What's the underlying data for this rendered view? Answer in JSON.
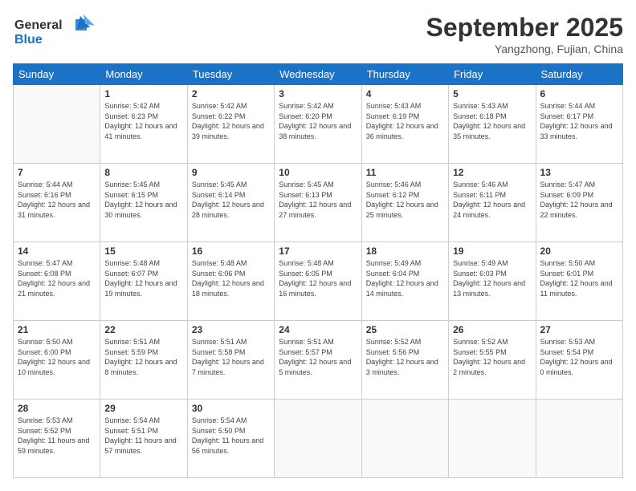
{
  "logo": {
    "line1": "General",
    "line2": "Blue"
  },
  "title": "September 2025",
  "location": "Yangzhong, Fujian, China",
  "days_of_week": [
    "Sunday",
    "Monday",
    "Tuesday",
    "Wednesday",
    "Thursday",
    "Friday",
    "Saturday"
  ],
  "weeks": [
    [
      {
        "day": "",
        "detail": ""
      },
      {
        "day": "1",
        "detail": "Sunrise: 5:42 AM\nSunset: 6:23 PM\nDaylight: 12 hours\nand 41 minutes."
      },
      {
        "day": "2",
        "detail": "Sunrise: 5:42 AM\nSunset: 6:22 PM\nDaylight: 12 hours\nand 39 minutes."
      },
      {
        "day": "3",
        "detail": "Sunrise: 5:42 AM\nSunset: 6:20 PM\nDaylight: 12 hours\nand 38 minutes."
      },
      {
        "day": "4",
        "detail": "Sunrise: 5:43 AM\nSunset: 6:19 PM\nDaylight: 12 hours\nand 36 minutes."
      },
      {
        "day": "5",
        "detail": "Sunrise: 5:43 AM\nSunset: 6:18 PM\nDaylight: 12 hours\nand 35 minutes."
      },
      {
        "day": "6",
        "detail": "Sunrise: 5:44 AM\nSunset: 6:17 PM\nDaylight: 12 hours\nand 33 minutes."
      }
    ],
    [
      {
        "day": "7",
        "detail": "Sunrise: 5:44 AM\nSunset: 6:16 PM\nDaylight: 12 hours\nand 31 minutes."
      },
      {
        "day": "8",
        "detail": "Sunrise: 5:45 AM\nSunset: 6:15 PM\nDaylight: 12 hours\nand 30 minutes."
      },
      {
        "day": "9",
        "detail": "Sunrise: 5:45 AM\nSunset: 6:14 PM\nDaylight: 12 hours\nand 28 minutes."
      },
      {
        "day": "10",
        "detail": "Sunrise: 5:45 AM\nSunset: 6:13 PM\nDaylight: 12 hours\nand 27 minutes."
      },
      {
        "day": "11",
        "detail": "Sunrise: 5:46 AM\nSunset: 6:12 PM\nDaylight: 12 hours\nand 25 minutes."
      },
      {
        "day": "12",
        "detail": "Sunrise: 5:46 AM\nSunset: 6:11 PM\nDaylight: 12 hours\nand 24 minutes."
      },
      {
        "day": "13",
        "detail": "Sunrise: 5:47 AM\nSunset: 6:09 PM\nDaylight: 12 hours\nand 22 minutes."
      }
    ],
    [
      {
        "day": "14",
        "detail": "Sunrise: 5:47 AM\nSunset: 6:08 PM\nDaylight: 12 hours\nand 21 minutes."
      },
      {
        "day": "15",
        "detail": "Sunrise: 5:48 AM\nSunset: 6:07 PM\nDaylight: 12 hours\nand 19 minutes."
      },
      {
        "day": "16",
        "detail": "Sunrise: 5:48 AM\nSunset: 6:06 PM\nDaylight: 12 hours\nand 18 minutes."
      },
      {
        "day": "17",
        "detail": "Sunrise: 5:48 AM\nSunset: 6:05 PM\nDaylight: 12 hours\nand 16 minutes."
      },
      {
        "day": "18",
        "detail": "Sunrise: 5:49 AM\nSunset: 6:04 PM\nDaylight: 12 hours\nand 14 minutes."
      },
      {
        "day": "19",
        "detail": "Sunrise: 5:49 AM\nSunset: 6:03 PM\nDaylight: 12 hours\nand 13 minutes."
      },
      {
        "day": "20",
        "detail": "Sunrise: 5:50 AM\nSunset: 6:01 PM\nDaylight: 12 hours\nand 11 minutes."
      }
    ],
    [
      {
        "day": "21",
        "detail": "Sunrise: 5:50 AM\nSunset: 6:00 PM\nDaylight: 12 hours\nand 10 minutes."
      },
      {
        "day": "22",
        "detail": "Sunrise: 5:51 AM\nSunset: 5:59 PM\nDaylight: 12 hours\nand 8 minutes."
      },
      {
        "day": "23",
        "detail": "Sunrise: 5:51 AM\nSunset: 5:58 PM\nDaylight: 12 hours\nand 7 minutes."
      },
      {
        "day": "24",
        "detail": "Sunrise: 5:51 AM\nSunset: 5:57 PM\nDaylight: 12 hours\nand 5 minutes."
      },
      {
        "day": "25",
        "detail": "Sunrise: 5:52 AM\nSunset: 5:56 PM\nDaylight: 12 hours\nand 3 minutes."
      },
      {
        "day": "26",
        "detail": "Sunrise: 5:52 AM\nSunset: 5:55 PM\nDaylight: 12 hours\nand 2 minutes."
      },
      {
        "day": "27",
        "detail": "Sunrise: 5:53 AM\nSunset: 5:54 PM\nDaylight: 12 hours\nand 0 minutes."
      }
    ],
    [
      {
        "day": "28",
        "detail": "Sunrise: 5:53 AM\nSunset: 5:52 PM\nDaylight: 11 hours\nand 59 minutes."
      },
      {
        "day": "29",
        "detail": "Sunrise: 5:54 AM\nSunset: 5:51 PM\nDaylight: 11 hours\nand 57 minutes."
      },
      {
        "day": "30",
        "detail": "Sunrise: 5:54 AM\nSunset: 5:50 PM\nDaylight: 11 hours\nand 56 minutes."
      },
      {
        "day": "",
        "detail": ""
      },
      {
        "day": "",
        "detail": ""
      },
      {
        "day": "",
        "detail": ""
      },
      {
        "day": "",
        "detail": ""
      }
    ]
  ]
}
